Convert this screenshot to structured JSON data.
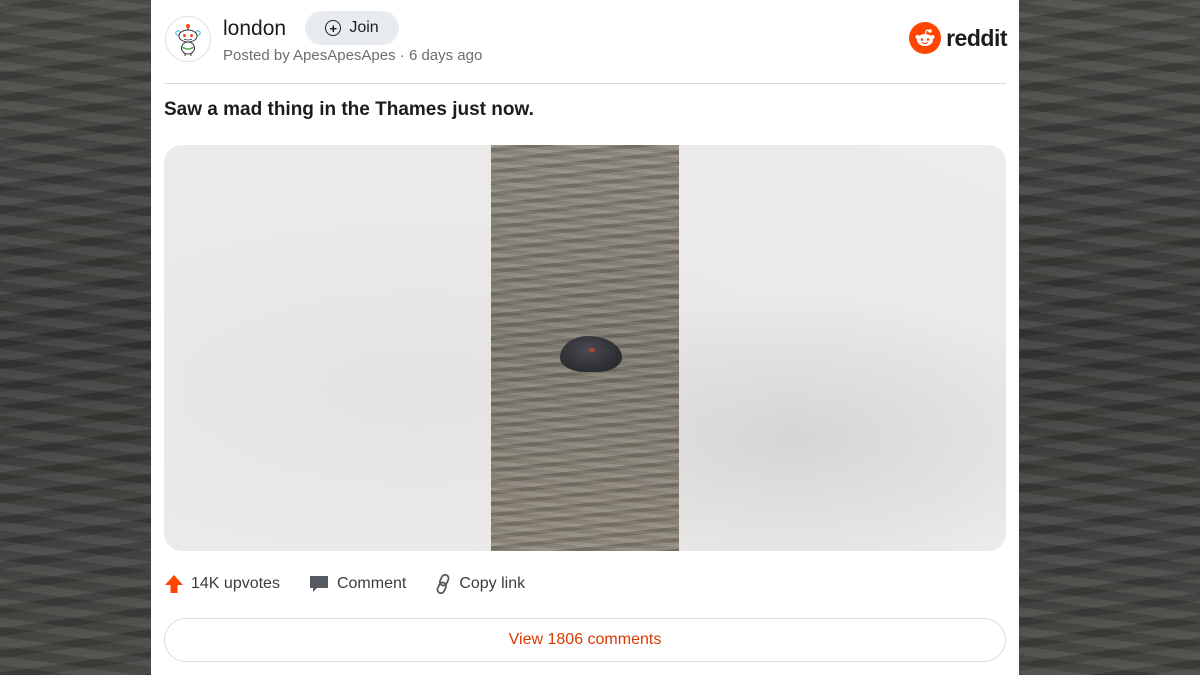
{
  "post": {
    "subreddit": "london",
    "join_label": "Join",
    "posted_by": "Posted by ApesApesApes · 6 days ago",
    "brand": "reddit",
    "title": "Saw a mad thing in the Thames just now."
  },
  "actions": {
    "upvotes_label": "14K upvotes",
    "comment_label": "Comment",
    "copy_link_label": "Copy link"
  },
  "footer": {
    "view_comments_label": "View 1806 comments"
  },
  "colors": {
    "accent": "#ff4500",
    "link": "#d93a00",
    "text": "#1c1c1c",
    "muted": "#6b6e72"
  },
  "icons": [
    "snoo-icon",
    "plus-circle-icon",
    "reddit-logo-icon",
    "upvote-arrow-icon",
    "comment-icon",
    "link-icon"
  ]
}
